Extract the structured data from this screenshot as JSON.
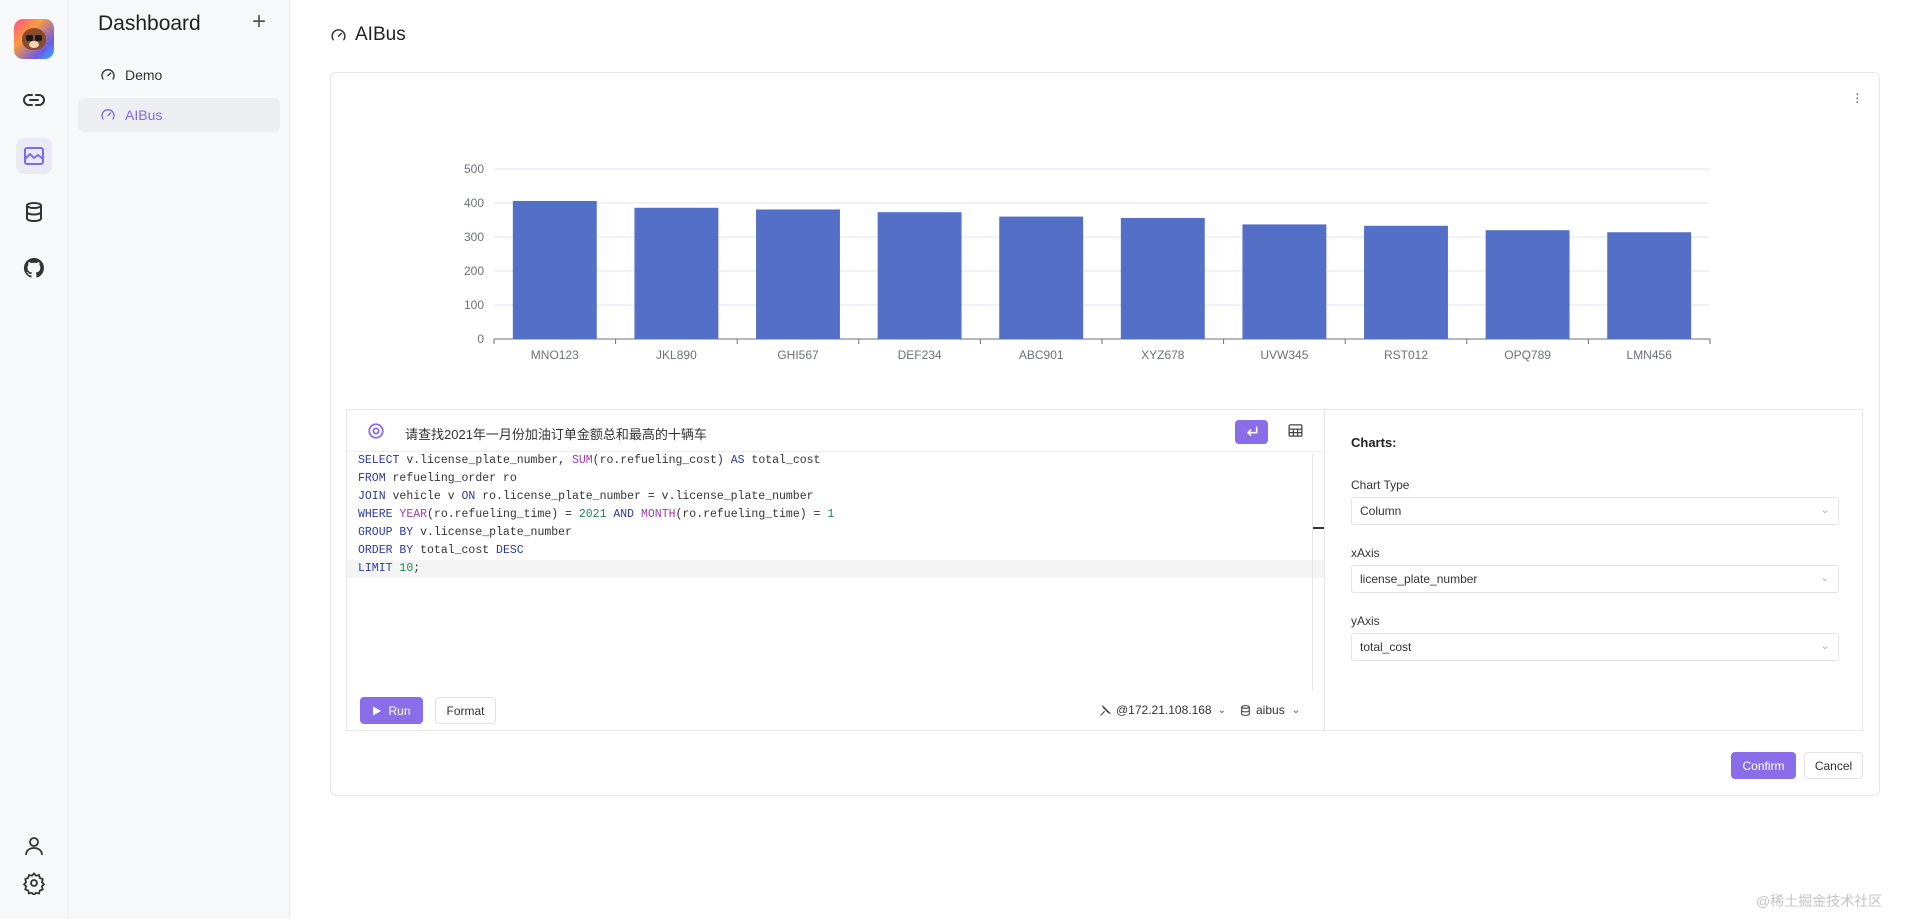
{
  "rail": {
    "items": [
      "link-icon",
      "chart-icon",
      "database-icon",
      "github-icon"
    ],
    "bottom": [
      "user-icon",
      "settings-icon"
    ]
  },
  "sidebar": {
    "title": "Dashboard",
    "add_label": "+",
    "items": [
      {
        "label": "Demo",
        "icon": "gauge-icon",
        "active": false
      },
      {
        "label": "AIBus",
        "icon": "gauge-icon",
        "active": true
      }
    ]
  },
  "page": {
    "title": "AIBus"
  },
  "chart_data": {
    "type": "bar",
    "title": "",
    "xlabel": "",
    "ylabel": "",
    "categories": [
      "MNO123",
      "JKL890",
      "GHI567",
      "DEF234",
      "ABC901",
      "XYZ678",
      "UVW345",
      "RST012",
      "OPQ789",
      "LMN456"
    ],
    "values": [
      406,
      386,
      381,
      373,
      360,
      356,
      337,
      333,
      320,
      314
    ],
    "ylim": [
      0,
      500
    ],
    "yticks": [
      0,
      100,
      200,
      300,
      400,
      500
    ],
    "color": "#5470c6",
    "grid": true
  },
  "editor": {
    "prompt": "请查找2021年一月份加油订单金额总和最高的十辆车",
    "code_lines": [
      [
        {
          "t": "SELECT",
          "c": "kw"
        },
        {
          "t": " v.license_plate_number, ",
          "c": ""
        },
        {
          "t": "SUM",
          "c": "fn"
        },
        {
          "t": "(ro.refueling_cost) ",
          "c": ""
        },
        {
          "t": "AS",
          "c": "kw"
        },
        {
          "t": " total_cost",
          "c": ""
        }
      ],
      [
        {
          "t": "FROM",
          "c": "kw"
        },
        {
          "t": " refueling_order ro",
          "c": ""
        }
      ],
      [
        {
          "t": "JOIN",
          "c": "kw"
        },
        {
          "t": " vehicle v ",
          "c": ""
        },
        {
          "t": "ON",
          "c": "kw"
        },
        {
          "t": " ro.license_plate_number = v.license_plate_number",
          "c": ""
        }
      ],
      [
        {
          "t": "WHERE",
          "c": "kw"
        },
        {
          "t": " ",
          "c": ""
        },
        {
          "t": "YEAR",
          "c": "fn"
        },
        {
          "t": "(ro.refueling_time) = ",
          "c": ""
        },
        {
          "t": "2021",
          "c": "num"
        },
        {
          "t": " AND ",
          "c": "kw"
        },
        {
          "t": "MONTH",
          "c": "fn"
        },
        {
          "t": "(ro.refueling_time) = ",
          "c": ""
        },
        {
          "t": "1",
          "c": "num"
        }
      ],
      [
        {
          "t": "GROUP BY",
          "c": "kw"
        },
        {
          "t": " v.license_plate_number",
          "c": ""
        }
      ],
      [
        {
          "t": "ORDER BY",
          "c": "kw"
        },
        {
          "t": " total_cost ",
          "c": ""
        },
        {
          "t": "DESC",
          "c": "kw"
        }
      ],
      [
        {
          "t": "LIMIT",
          "c": "kw"
        },
        {
          "t": " ",
          "c": ""
        },
        {
          "t": "10",
          "c": "num"
        },
        {
          "t": ";",
          "c": ""
        }
      ]
    ],
    "run_label": "Run",
    "format_label": "Format",
    "connection": "@172.21.108.168",
    "database": "aibus"
  },
  "settings": {
    "heading": "Charts:",
    "chart_type_label": "Chart Type",
    "chart_type_value": "Column",
    "xaxis_label": "xAxis",
    "xaxis_value": "license_plate_number",
    "yaxis_label": "yAxis",
    "yaxis_value": "total_cost"
  },
  "actions": {
    "confirm": "Confirm",
    "cancel": "Cancel"
  },
  "watermark": "@稀土掘金技术社区"
}
